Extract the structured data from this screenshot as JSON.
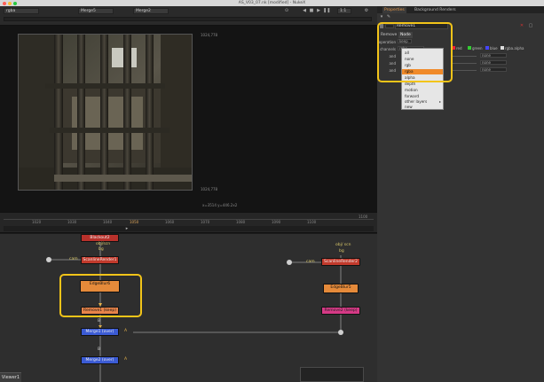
{
  "window": {
    "title": "AS_V03_07.nk [modified] - NukeX"
  },
  "viewer_toolbar": {
    "input_a": "Merge5",
    "input_b": "Merge2",
    "zoom": "1:1",
    "channel_mode": "rgba",
    "frame_btn": "default"
  },
  "viewer": {
    "res_top_right": "1024,778",
    "res_bottom_right": "1024,778",
    "status_readout": "x=3514 y=446.2x2",
    "res_top_left": "0,0"
  },
  "timeline": {
    "ticks": [
      "1020",
      "1030",
      "1040",
      "1050",
      "1060",
      "1070",
      "1080",
      "1090",
      "1100"
    ],
    "current_frame": "1050",
    "end_frame": "1100"
  },
  "nodegraph": {
    "nodes": {
      "blackout": "Blackout2",
      "scanline_left": "ScanlineRender1",
      "edgeblur_left": "EdgeBlur6",
      "remove_left": "Remove1 (keep)",
      "merge_a": "Merge1 (over)",
      "merge_b": "Merge2 (over)",
      "scanline_right": "ScanlineRender2",
      "edgeblur_right": "EdgeBlur5",
      "remove_right": "Remove2 (keep)"
    },
    "labels": {
      "obj_scn_left": "obj/scn",
      "bg_left": "bg",
      "cam_left": "cam",
      "obj_scn_right": "obj/ scn",
      "bg_right": "bg",
      "cam_right": "cam",
      "a_label": "A",
      "b_label": "B",
      "a_label2": "A",
      "b_label2": "B"
    }
  },
  "bottom_tabs": {
    "viewer1": "Viewer1"
  },
  "panel": {
    "tabs": {
      "properties": "Properties",
      "background_renders": "Background Renders"
    },
    "node_name": "Remove1",
    "subtabs": {
      "remove": "Remove",
      "node": "Node"
    },
    "rows": {
      "operation_label": "operation",
      "operation_value": "keep",
      "channels_label": "channels",
      "channels_value": "rgba",
      "and1_label": "and",
      "and2_label": "and",
      "and3_label": "and"
    },
    "channel_checks": {
      "red": "red",
      "green": "green",
      "blue": "blue",
      "alpha": "rgba.alpha"
    },
    "none_values": [
      "none",
      "none",
      "none"
    ]
  },
  "dropdown": {
    "items": [
      "all",
      "none",
      "rgb",
      "rgba",
      "alpha",
      "depth",
      "motion",
      "forward",
      "other layers",
      "new"
    ],
    "selected": "rgba"
  },
  "colors": {
    "highlight": "#f2c419",
    "node_orange": "#e58a3a",
    "node_red": "#b8312b",
    "node_blue": "#3b5bd4",
    "node_pink": "#d63a86"
  }
}
